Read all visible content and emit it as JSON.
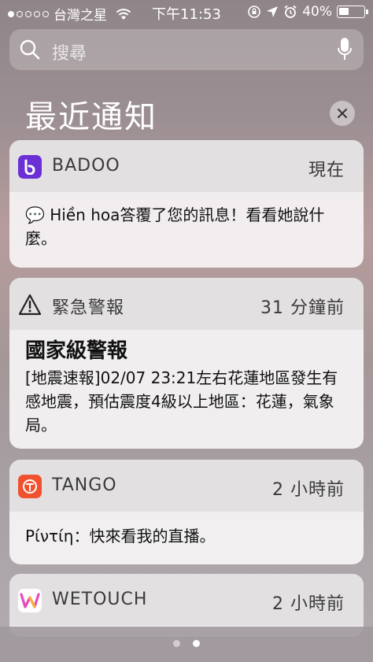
{
  "status_bar": {
    "carrier": "台灣之星",
    "time": "下午11:53",
    "battery": "40%",
    "battery_level": 0.4
  },
  "search": {
    "placeholder": "搜尋"
  },
  "section": {
    "title": "最近通知",
    "clear_label": "×"
  },
  "notifications": [
    {
      "app": "BADOO",
      "time": "現在",
      "icon": "badoo-icon",
      "icon_color": "#6b2fd6",
      "body": "💬 Hiền hoa答覆了您的訊息！看看她說什麼。"
    },
    {
      "app": "緊急警報",
      "time": "31 分鐘前",
      "icon": "warning-icon",
      "title": "國家級警報",
      "body": "[地震速報]02/07 23:21左右花蓮地區發生有感地震，預估震度4級以上地區：花蓮，氣象局。"
    },
    {
      "app": "TANGO",
      "time": "2 小時前",
      "icon": "tango-icon",
      "icon_color": "#f0522f",
      "body": "Ρίντίη：快來看我的直播。"
    },
    {
      "app": "WETOUCH",
      "time": "2 小時前",
      "icon": "wetouch-icon",
      "icon_color": "#e64ab8"
    }
  ],
  "pagination": {
    "pages": 2,
    "active": 2
  }
}
